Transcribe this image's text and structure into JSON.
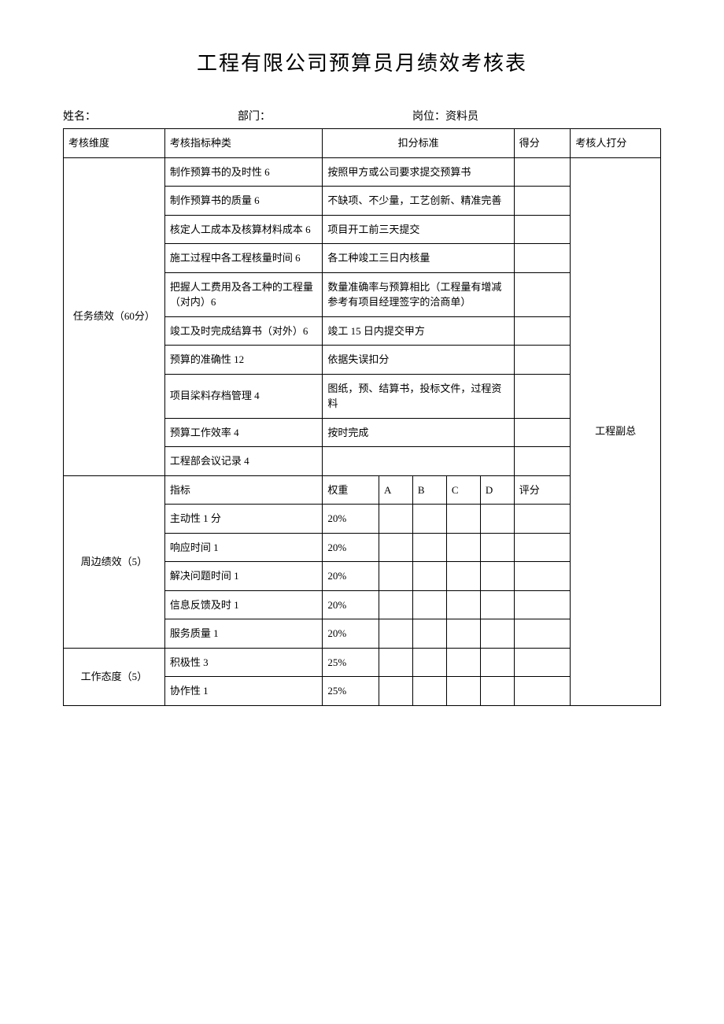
{
  "title": "工程有限公司预算员月绩效考核表",
  "header": {
    "name_label": "姓名：",
    "dept_label": "部门：",
    "position_label": "岗位：",
    "position_value": "资料员"
  },
  "columns": {
    "dimension": "考核维度",
    "indicator": "考核指标种类",
    "standard": "扣分标准",
    "score": "得分",
    "assessor": "考核人打分"
  },
  "section1": {
    "dimension": "任务绩效（60分）",
    "rows": [
      {
        "indicator": "制作预算书的及时性 6",
        "standard": "按照甲方或公司要求提交预算书"
      },
      {
        "indicator": "制作预算书的质量 6",
        "standard": "不缺项、不少量，工艺创新、精准完善"
      },
      {
        "indicator": "核定人工成本及核算材料成本 6",
        "standard": "项目开工前三天提交"
      },
      {
        "indicator": "施工过程中各工程核量时间 6",
        "standard": "各工种竣工三日内核量"
      },
      {
        "indicator": "把握人工费用及各工种的工程量（对内）6",
        "standard": "数量准确率与预算相比（工程量有增减参考有项目经理签字的洽商单）"
      },
      {
        "indicator": "竣工及时完成结算书（对外）6",
        "standard": "竣工 15 日内提交甲方"
      },
      {
        "indicator": "预算的准确性 12",
        "standard": "依据失误扣分"
      },
      {
        "indicator": "项目桬料存档管理 4",
        "standard": "图纸，预、结算书，投标文件，过程资料"
      },
      {
        "indicator": "预算工作效率 4",
        "standard": "按时完成"
      },
      {
        "indicator": "工程部会议记录 4",
        "standard": ""
      }
    ],
    "assessor": "工程副总"
  },
  "section2": {
    "dimension": "周边绩效（5）",
    "header": {
      "indicator": "指标",
      "weight": "权重",
      "a": "A",
      "b": "B",
      "c": "C",
      "d": "D",
      "score": "评分"
    },
    "rows": [
      {
        "indicator": "主动性 1 分",
        "weight": "20%"
      },
      {
        "indicator": "响应时间 1",
        "weight": "20%"
      },
      {
        "indicator": "解决问题时间 1",
        "weight": "20%"
      },
      {
        "indicator": "信息反馈及时 1",
        "weight": "20%"
      },
      {
        "indicator": "服务质量 1",
        "weight": "20%"
      }
    ]
  },
  "section3": {
    "dimension": "工作态度（5）",
    "rows": [
      {
        "indicator": "积极性 3",
        "weight": "25%"
      },
      {
        "indicator": "协作性 1",
        "weight": "25%"
      }
    ]
  }
}
